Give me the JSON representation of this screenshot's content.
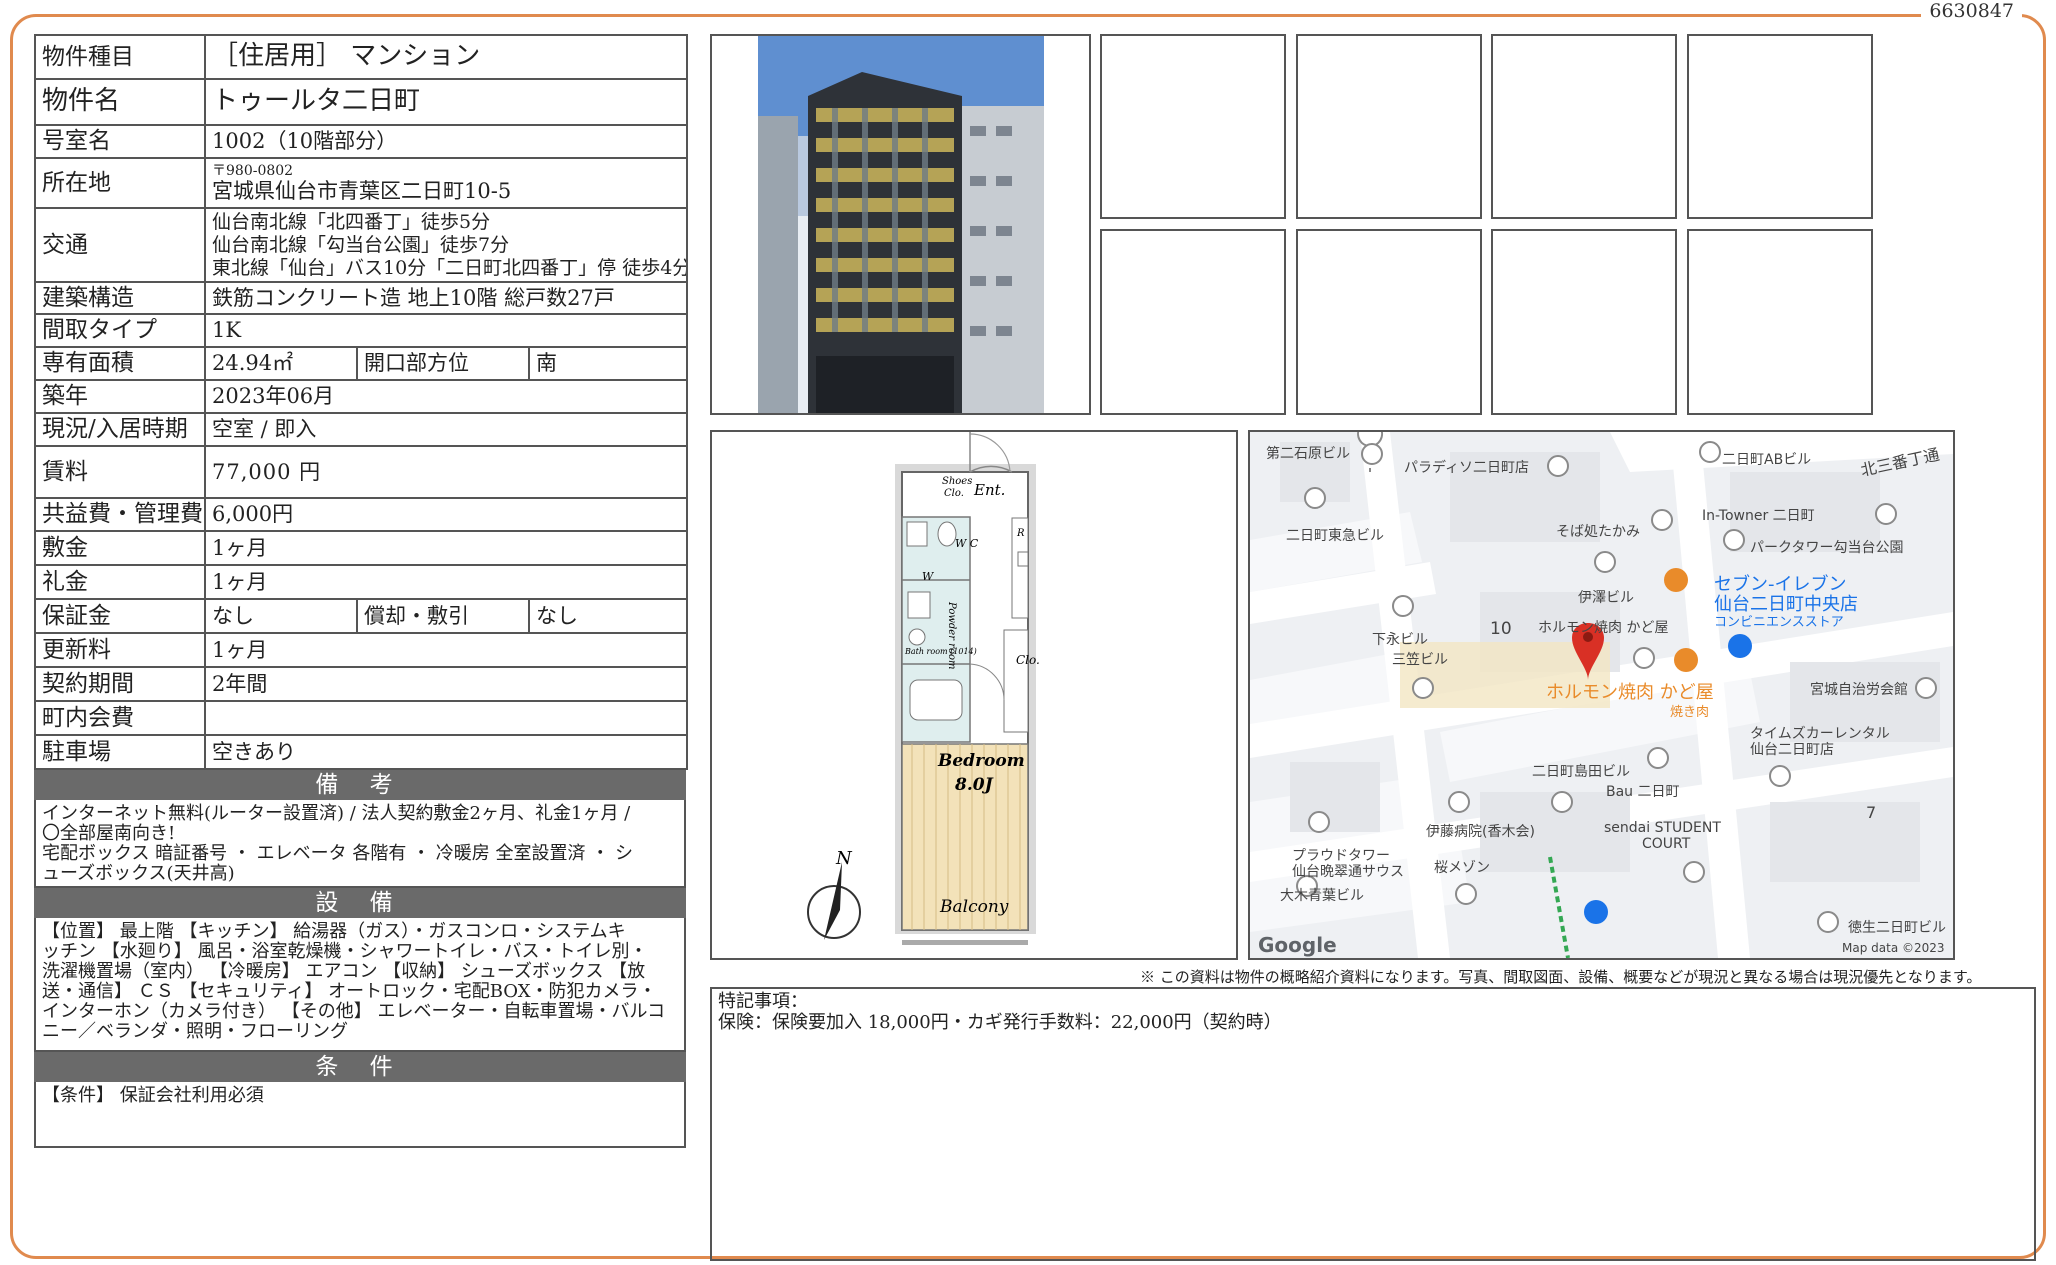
{
  "doc_id": "6630847",
  "rows": {
    "type_label": "物件種目",
    "type_value": "［住居用］ マンション",
    "name_label": "物件名",
    "name_value": "トゥールタ二日町",
    "room_label": "号室名",
    "room_value": "1002（10階部分）",
    "addr_label": "所在地",
    "addr_zip": "〒980-0802",
    "addr_value": "宮城県仙台市青葉区二日町10-5",
    "access_label": "交通",
    "access_lines": [
      "仙台南北線「北四番丁」徒歩5分",
      "仙台南北線「勾当台公園」徒歩7分",
      "東北線「仙台」バス10分「二日町北四番丁」停 徒歩4分"
    ],
    "structure_label": "建築構造",
    "structure_value": "鉄筋コンクリート造 地上10階 総戸数27戸",
    "layout_label": "間取タイプ",
    "layout_value": "1K",
    "area_label": "専有面積",
    "area_value": "24.94㎡",
    "facing_label": "開口部方位",
    "facing_value": "南",
    "built_label": "築年",
    "built_value": "2023年06月",
    "status_label": "現況/入居時期",
    "status_value": "空室 / 即入",
    "rent_label": "賃料",
    "rent_value": "77,000 円",
    "fee_label": "共益費・管理費",
    "fee_value": "6,000円",
    "deposit_label": "敷金",
    "deposit_value": "1ヶ月",
    "keymoney_label": "礼金",
    "keymoney_value": "1ヶ月",
    "guarantee_label": "保証金",
    "guarantee_value": "なし",
    "amort_label": "償却・敷引",
    "amort_value": "なし",
    "renewal_label": "更新料",
    "renewal_value": "1ヶ月",
    "term_label": "契約期間",
    "term_value": "2年間",
    "assoc_label": "町内会費",
    "assoc_value": "",
    "parking_label": "駐車場",
    "parking_value": "空きあり"
  },
  "remarks": {
    "title": "備 考",
    "lines": [
      "インターネット無料(ルーター設置済) / 法人契約敷金2ヶ月、礼金1ヶ月 /",
      "〇全部屋南向き!",
      "宅配ボックス 暗証番号 ・ エレベータ 各階有 ・ 冷暖房 全室設置済 ・ シ",
      "ューズボックス(天井高)"
    ]
  },
  "equipment": {
    "title": "設 備",
    "lines": [
      "【位置】 最上階 【キッチン】 給湯器（ガス）・ガスコンロ・システムキ",
      "ッチン 【水廻り】 風呂・浴室乾燥機・シャワートイレ・バス・トイレ別・",
      "洗濯機置場（室内） 【冷暖房】 エアコン 【収納】 シューズボックス 【放",
      "送・通信】 ＣＳ 【セキュリティ】 オートロック・宅配BOX・防犯カメラ・",
      "インターホン（カメラ付き） 【その他】 エレベーター・自転車置場・バルコ",
      "ニー／ベランダ・照明・フローリング"
    ]
  },
  "conditions": {
    "title": "条 件",
    "text": "【条件】 保証会社利用必須"
  },
  "floorplan": {
    "shoes": "Shoes",
    "clo1": "Clo.",
    "ent": "Ent.",
    "wc": "W C",
    "r": "R",
    "w": "W",
    "powder": "Powder room",
    "bath": "Bath room (1014)",
    "clo2": "Clo.",
    "bedroom": "Bedroom",
    "size": "8.0J",
    "balcony": "Balcony",
    "north": "N"
  },
  "map": {
    "labels": [
      "第二石原ビル",
      "パラディソ二日町店",
      "二日町ABビル",
      "北三番丁通",
      "二日町東急ビル",
      "そば処たかみ",
      "In-Towner 二日町",
      "パークタワー勾当台公園",
      "伊澤ビル",
      "セブン-イレブン",
      "仙台二日町中央店",
      "コンビニエンスストア",
      "下永ビル",
      "10",
      "ホルモン焼肉 かど屋",
      "三笠ビル",
      "ホルモン焼肉 かど屋",
      "焼き肉",
      "宮城自治労会館",
      "タイムズカーレンタル",
      "仙台二日町店",
      "二日町島田ビル",
      "Bau 二日町",
      "7",
      "伊藤病院(香木会)",
      "sendai STUDENT",
      "COURT",
      "プラウドタワー",
      "仙台晩翠通サウス",
      "桜メゾン",
      "大木青葉ビル",
      "徳生二日町ビル",
      "Google",
      "Map data ©2023"
    ]
  },
  "note": "※ この資料は物件の概略紹介資料になります。写真、間取図面、設備、概要などが現況と異なる場合は現況優先となります。",
  "tokki": {
    "title": "特記事項：",
    "text": "保険：保険要加入 18,000円・カギ発行手数料：22,000円（契約時）"
  },
  "colors": {
    "frame": "#e08a4e",
    "section_header": "#6a6a6a",
    "map_pin": "#d93025",
    "map_poi_orange": "#e98b2a",
    "map_blue": "#1a73e8"
  }
}
